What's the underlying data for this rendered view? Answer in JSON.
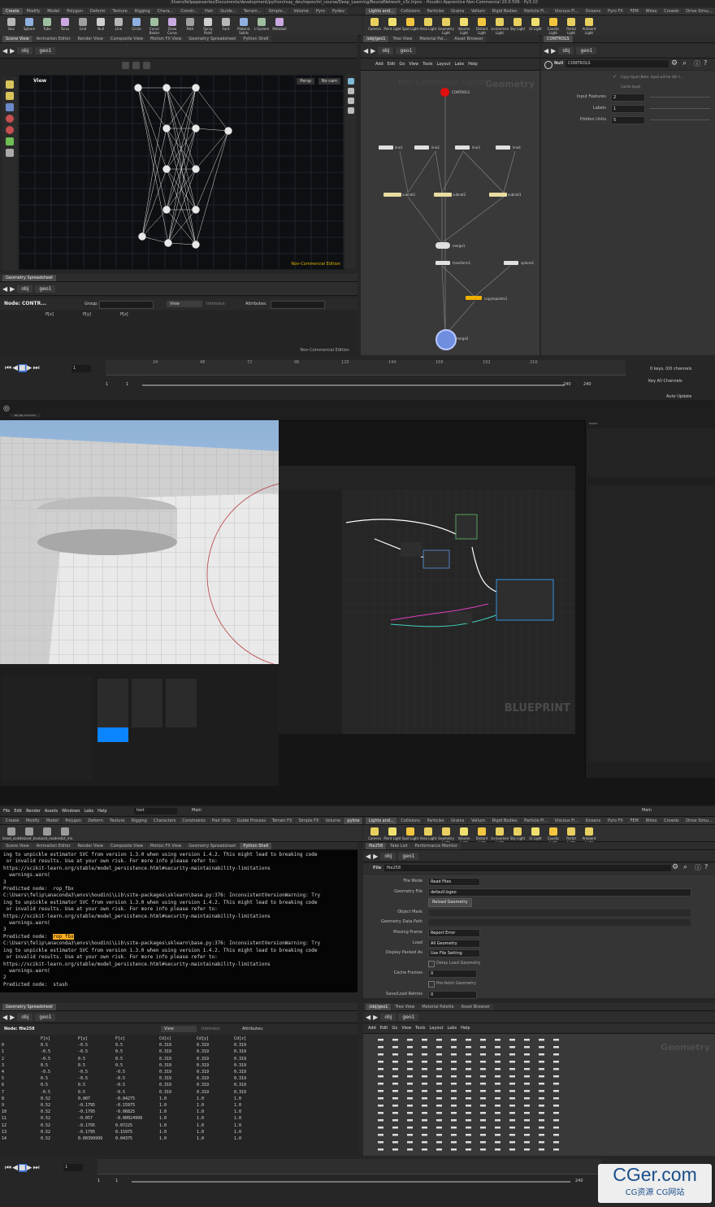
{
  "window_title": "/Users/felipepesantez/Documents/development/python/rxay_dev/repos/ml_course/Deep_Learning/NeuralNetwork_v3c.hipnc - Houdini Apprentice Non-Commercial 20.0.506 - Py3.10",
  "top": {
    "shelf_tabs": [
      "Create",
      "Modify",
      "Model",
      "Polygon",
      "Deform",
      "Texture",
      "Rigging",
      "Chara...",
      "Constr...",
      "Hair",
      "Guide...",
      "Terrain...",
      "Simple...",
      "Volume",
      "Pyro",
      "Pydev"
    ],
    "shelf_tools": [
      "Box",
      "Sphere",
      "Tube",
      "Torus",
      "Grid",
      "Null",
      "Line",
      "Circle",
      "Curve Bezier",
      "Draw Curve",
      "Path",
      "Spray Paint",
      "Font",
      "Platonic Solids",
      "L-System",
      "Metaball"
    ],
    "light_tabs": [
      "Lights and...",
      "Collisions",
      "Particles",
      "Grains",
      "Vellum",
      "Rigid Bodies",
      "Particle Fl...",
      "Viscous Fl...",
      "Oceans",
      "Pyro FX",
      "FEM",
      "Wires",
      "Crowds",
      "Drive Simu..."
    ],
    "light_tools": [
      "Camera",
      "Point Light",
      "Spot Light",
      "Area Light",
      "Geometry Light",
      "Volume Light",
      "Distant Light",
      "Environment Light",
      "Sky Light",
      "GI Light",
      "Caustic Light",
      "Portal Light",
      "Ambient Light"
    ],
    "pane_tabs": [
      "Scene View",
      "Animation Editor",
      "Render View",
      "Composite View",
      "Motion FX View",
      "Geometry Spreadsheet",
      "Python Shell"
    ],
    "path_obj": "obj",
    "path_geo": "geo1",
    "viewport_label": "View",
    "persp": "Persp",
    "nocam": "No cam",
    "noncommercial": "Non-Commercial Edition",
    "network_tabs": [
      "/obj/geo1",
      "Tree View",
      "Material Pal...",
      "Asset Browser"
    ],
    "network_menu": [
      "Add",
      "Edit",
      "Go",
      "View",
      "Tools",
      "Layout",
      "Labs",
      "Help"
    ],
    "network_watermark": "Geometry",
    "network_noncommercial": "Non-Commercial Edition",
    "nodes": {
      "controls": "CONTROLS",
      "line1": "line1",
      "line2": "line2",
      "line3": "line3",
      "line4": "line4",
      "subnet1": "subnet1",
      "subnet2": "subnet2",
      "subnet3": "subnet3",
      "merge1": "merge1",
      "transform1": "transform1",
      "sphere1": "sphere1",
      "copytopoints1": "copytopoints1",
      "merge2": "merge2"
    },
    "parm_tab": "CONTROLS",
    "parm_type": "Null",
    "parm_name": "CONTROLS",
    "copy_input_note": "Copy Input (Note: Input will be still c...",
    "cache_input": "Cache Input",
    "parms": [
      {
        "label": "Input Features",
        "value": "2"
      },
      {
        "label": "Labels",
        "value": "1"
      },
      {
        "label": "Hidden Units",
        "value": "5"
      }
    ],
    "spreadsheet_tab": "Geometry Spreadsheet",
    "spreadsheet_node": "Node: CONTR...",
    "spreadsheet_group": "Group:",
    "spreadsheet_view": "View",
    "spreadsheet_intrinsics": "Intrinsics",
    "spreadsheet_attributes": "Attributes:",
    "spreadsheet_cols": [
      "P[x]",
      "P[y]",
      "P[z]"
    ],
    "spreadsheet_noncommercial": "Non-Commercial Edition",
    "timeline_ticks": [
      "24",
      "48",
      "72",
      "96",
      "120",
      "144",
      "168",
      "192",
      "216"
    ],
    "frame": "1",
    "frame_start": "1",
    "frame_start2": "1",
    "frame_end": "240",
    "frame_end2": "240",
    "keys_info": "0 keys, 0/0 channels",
    "key_all": "Key All Channels",
    "auto_update": "Auto Update"
  },
  "middle": {
    "watermark": "BLUEPRINT",
    "ue_tab": "BP_NN_Character",
    "details": "Details"
  },
  "bottom": {
    "menu": [
      "File",
      "Edit",
      "Render",
      "Assets",
      "Windows",
      "Labs",
      "Help"
    ],
    "desktop": "test",
    "main": "Main",
    "shelf_tabs": [
      "Create",
      "Modify",
      "Model",
      "Polygon",
      "Deform",
      "Texture",
      "Rigging",
      "Characters",
      "Constraints",
      "Hair Utils",
      "Guide Process",
      "Terrain FX",
      "Simple FX",
      "Volume",
      "pyline"
    ],
    "shelf_tools": [
      "Sinked_nodes",
      "dataset_test",
      "dataset_mod...",
      "predict_mn..."
    ],
    "pane_tabs": [
      "Scene View",
      "Animation Editor",
      "Render View",
      "Composite View",
      "Motion FX View",
      "Geometry Spreadsheet",
      "Python Shell"
    ],
    "console_lines": [
      "ing to unpickle estimator SVC from version 1.3.0 when using version 1.4.2. This might lead to breaking code",
      " or invalid results. Use at your own risk. For more info please refer to:",
      "https://scikit-learn.org/stable/model_persistence.html#security-maintainability-limitations",
      "  warnings.warn(",
      "3",
      "Predicted node:  rop_fbx",
      "C:\\Users\\felip\\anaconda3\\envs\\houdini\\Lib\\site-packages\\sklearn\\base.py:376: InconsistentVersionWarning: Try",
      "ing to unpickle estimator SVC from version 1.3.0 when using version 1.4.2. This might lead to breaking code",
      " or invalid results. Use at your own risk. For more info please refer to:",
      "https://scikit-learn.org/stable/model_persistence.html#security-maintainability-limitations",
      "  warnings.warn(",
      "3",
      "Predicted node:  ",
      "C:\\Users\\felip\\anaconda3\\envs\\houdini\\Lib\\site-packages\\sklearn\\base.py:376: InconsistentVersionWarning: Try",
      "ing to unpickle estimator SVC from version 1.3.0 when using version 1.4.2. This might lead to breaking code",
      " or invalid results. Use at your own risk. For more info please refer to:",
      "https://scikit-learn.org/stable/model_persistence.html#security-maintainability-limitations",
      "  warnings.warn(",
      "2",
      "Predicted node:  stash"
    ],
    "highlight_word": "rop_fbx",
    "parm_tabs": [
      "file258",
      "Take List",
      "Performance Monitor"
    ],
    "path_obj": "obj",
    "path_geo": "geo1",
    "parm_type": "File",
    "parm_name": "file258",
    "parms": [
      {
        "label": "File Mode",
        "value": "Read Files"
      },
      {
        "label": "Geometry File",
        "value": "default.bgeo"
      },
      {
        "label": "",
        "value": "Reload Geometry"
      },
      {
        "label": "Object Mask",
        "value": ""
      },
      {
        "label": "Geometry Data Path",
        "value": ""
      },
      {
        "label": "Missing Frame",
        "value": "Report Error"
      },
      {
        "label": "Load",
        "value": "All Geometry"
      },
      {
        "label": "Display Packed As",
        "value": "Use File Setting"
      },
      {
        "label": "",
        "value": "Delay Load Geometry"
      },
      {
        "label": "Cache Frames",
        "value": "0"
      },
      {
        "label": "",
        "value": "Pre-fetch Geometry"
      },
      {
        "label": "Save/Load Retries",
        "value": "0"
      }
    ],
    "spreadsheet_tab": "Geometry Spreadsheet",
    "spreadsheet_node": "Node: file258",
    "spreadsheet_cols": [
      "",
      "P[x]",
      "P[y]",
      "P[z]",
      "Cd[x]",
      "Cd[y]",
      "Cd[z]"
    ],
    "spreadsheet_rows": [
      [
        "0",
        "0.5",
        "-0.5",
        "0.5",
        "0.319",
        "0.319",
        "0.319"
      ],
      [
        "1",
        "-0.5",
        "-0.5",
        "0.5",
        "0.319",
        "0.319",
        "0.319"
      ],
      [
        "2",
        "-0.5",
        "0.5",
        "0.5",
        "0.319",
        "0.319",
        "0.319"
      ],
      [
        "3",
        "0.5",
        "0.5",
        "0.5",
        "0.319",
        "0.319",
        "0.319"
      ],
      [
        "4",
        "-0.5",
        "-0.5",
        "-0.5",
        "0.319",
        "0.319",
        "0.319"
      ],
      [
        "5",
        "0.5",
        "-0.5",
        "-0.5",
        "0.319",
        "0.319",
        "0.319"
      ],
      [
        "6",
        "0.5",
        "0.5",
        "-0.5",
        "0.319",
        "0.319",
        "0.319"
      ],
      [
        "7",
        "-0.5",
        "0.5",
        "-0.5",
        "0.319",
        "0.319",
        "0.319"
      ],
      [
        "8",
        "0.52",
        "0.007",
        "-0.04275",
        "1.0",
        "1.0",
        "1.0"
      ],
      [
        "9",
        "0.52",
        "-0.1795",
        "-0.15975",
        "1.0",
        "1.0",
        "1.0"
      ],
      [
        "10",
        "0.52",
        "-0.1795",
        "-0.06825",
        "1.0",
        "1.0",
        "1.0"
      ],
      [
        "11",
        "0.52",
        "-0.057",
        "-0.00024999",
        "1.0",
        "1.0",
        "1.0"
      ],
      [
        "12",
        "0.52",
        "-0.1795",
        "0.07225",
        "1.0",
        "1.0",
        "1.0"
      ],
      [
        "13",
        "0.52",
        "-0.1795",
        "0.15975",
        "1.0",
        "1.0",
        "1.0"
      ],
      [
        "14",
        "0.52",
        "0.00399999",
        "0.04375",
        "1.0",
        "1.0",
        "1.0"
      ]
    ],
    "network_tabs": [
      "/obj/geo1",
      "Tree View",
      "Material Palette",
      "Asset Browser"
    ],
    "network_menu": [
      "Add",
      "Edit",
      "Go",
      "View",
      "Tools",
      "Layout",
      "Labs",
      "Help"
    ],
    "network_watermark": "Geometry",
    "frame": "1",
    "frame_start": "1",
    "frame_start2": "1",
    "frame_end": "240",
    "frame_end2": "240"
  },
  "watermark": {
    "main": "CGer.com",
    "sub": "CG资源 CG网站"
  }
}
